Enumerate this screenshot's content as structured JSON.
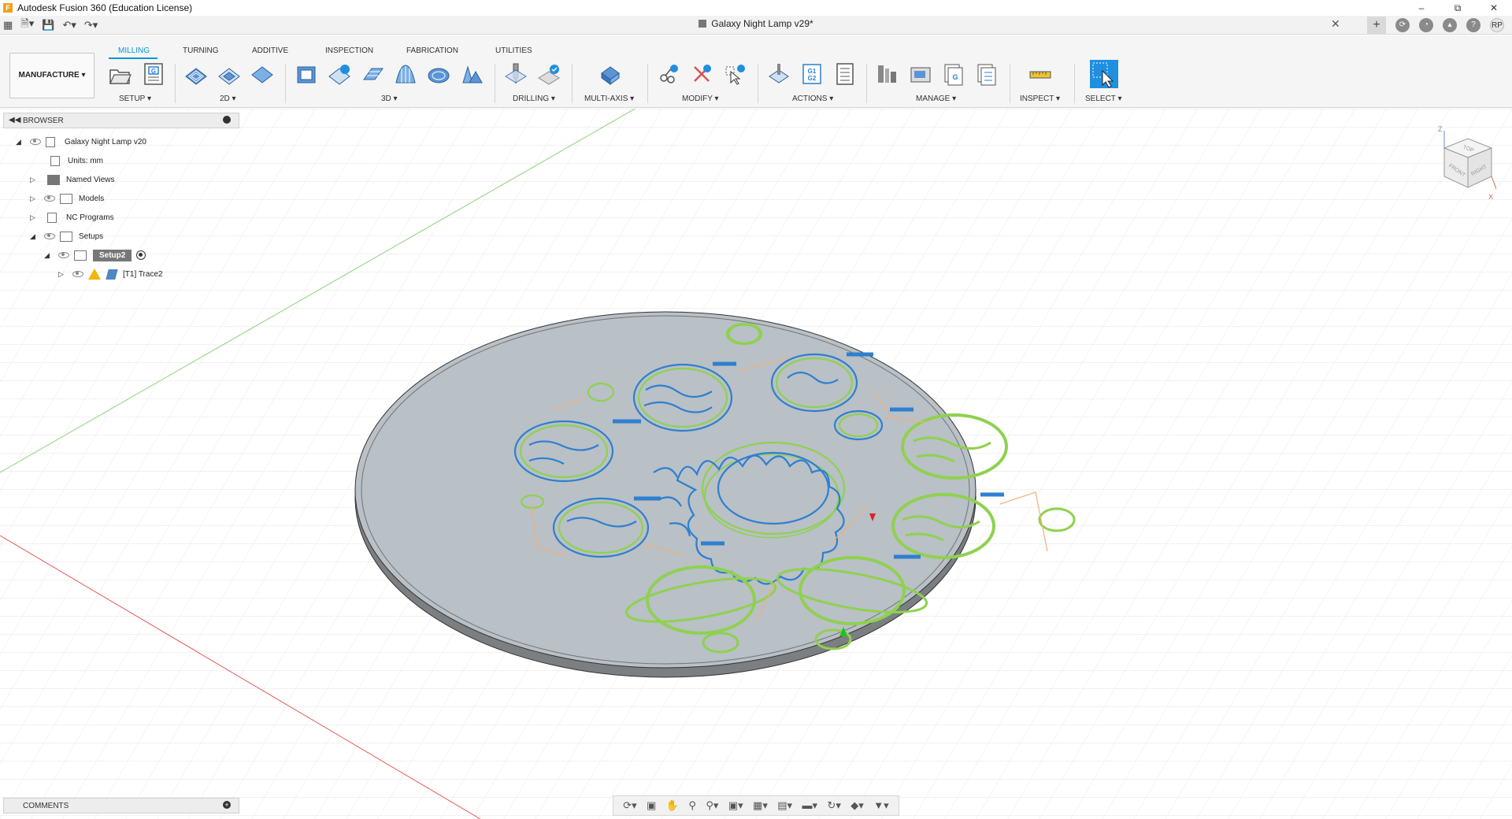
{
  "window": {
    "app_title": "Autodesk Fusion 360 (Education License)",
    "controls": [
      "–",
      "⧉",
      "✕"
    ]
  },
  "tabbar": {
    "doc_title": "Galaxy Night Lamp v29*",
    "close": "✕",
    "user_initials": "RP",
    "plus": "+"
  },
  "ribbon": {
    "workspace": "MANUFACTURE ▾",
    "tabs": [
      "MILLING",
      "TURNING",
      "ADDITIVE",
      "INSPECTION",
      "FABRICATION",
      "UTILITIES"
    ],
    "active_tab": "MILLING",
    "groups": [
      "SETUP ▾",
      "2D ▾",
      "3D ▾",
      "DRILLING ▾",
      "MULTI-AXIS ▾",
      "MODIFY ▾",
      "ACTIONS ▾",
      "MANAGE ▾",
      "INSPECT ▾",
      "SELECT ▾"
    ]
  },
  "browser": {
    "title": "BROWSER",
    "items": [
      {
        "label": "Galaxy Night Lamp v20"
      },
      {
        "label": "Units: mm"
      },
      {
        "label": "Named Views"
      },
      {
        "label": "Models"
      },
      {
        "label": "NC Programs"
      },
      {
        "label": "Setups"
      },
      {
        "label": "Setup2"
      },
      {
        "label": "[T1] Trace2"
      }
    ]
  },
  "comments": {
    "title": "COMMENTS"
  },
  "viewcube": {
    "faces": [
      "TOP",
      "FRONT",
      "RIGHT"
    ],
    "axes": [
      "Z",
      "X"
    ]
  },
  "colors": {
    "accent": "#0696d7",
    "stock": "#b9c0c6",
    "toolpath_green": "#8fd14f",
    "toolpath_blue": "#2e7fd0",
    "grid": "#e3e3e3"
  }
}
